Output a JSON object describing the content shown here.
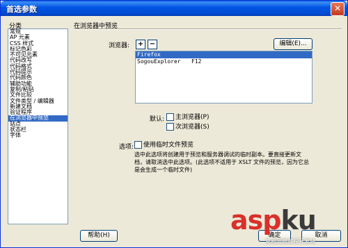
{
  "window": {
    "title": "首选参数",
    "close_glyph": "✕"
  },
  "categories": {
    "label": "分类",
    "items": [
      "常规",
      "AP 元素",
      "CSS 样式",
      "标记色彩",
      "不可见元素",
      "代码改写",
      "代码格式",
      "代码提示",
      "代码颜色",
      "辅助功能",
      "复制/粘贴",
      "文件比较",
      "文件类型 / 编辑器",
      "新建文档",
      "验证程序",
      "在浏览器中预览",
      "站点",
      "状态栏",
      "字体"
    ],
    "selected_index": 15
  },
  "section": {
    "title": "在浏览器中预览"
  },
  "browsers": {
    "label": "浏览器:",
    "add_glyph": "+",
    "remove_glyph": "−",
    "edit_button": "编辑(E)...",
    "list": [
      {
        "name": "Firefox",
        "key": ""
      },
      {
        "name": "SogouExplorer",
        "key": "F12"
      }
    ],
    "selected_index": 0
  },
  "defaults": {
    "label": "默认:",
    "primary": "主浏览器(P)",
    "primary_checked": false,
    "secondary": "次浏览器(S)",
    "secondary_checked": false
  },
  "options": {
    "label": "选项:",
    "temp_file": "使用临时文件预览",
    "temp_file_checked": false,
    "description": "选中此选项将创建用于预览和服务器调试的临时副本。要直接更新文档，请取消选中此选项。(此选项不适用于 XSLT 文件的预览，因为它总是会生成一个临时文件)"
  },
  "buttons": {
    "help": "帮助(H)",
    "ok": "确定",
    "cancel": "取消"
  },
  "watermark": {
    "asp": "asp",
    "ku": "ku",
    "sub": "免费网络编程开发站"
  },
  "colors": {
    "selection": "#316ac5",
    "titlebar": "#0054e3",
    "watermark_red": "#d9302a"
  }
}
